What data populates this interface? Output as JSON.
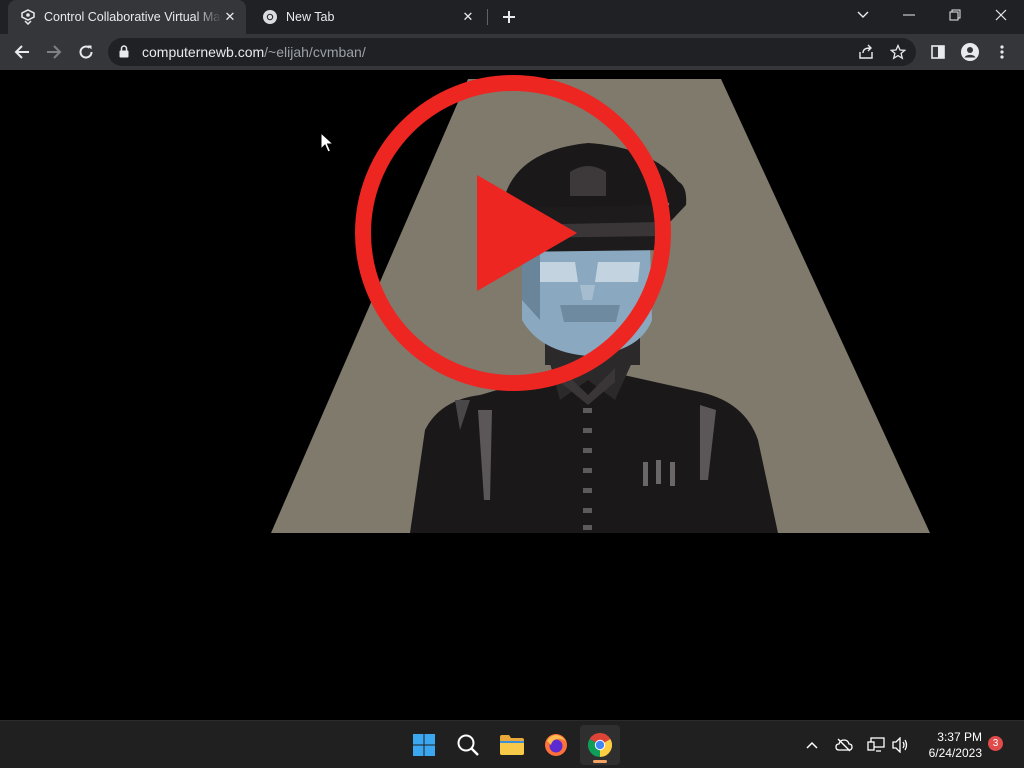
{
  "browser": {
    "tabs": [
      {
        "title": "Control Collaborative Virtual Mac",
        "active": true,
        "favicon": "cvm-favicon-icon"
      },
      {
        "title": "New Tab",
        "active": false,
        "favicon": "chrome-icon"
      }
    ],
    "url": {
      "host": "computernewb.com",
      "path": "/~elijah/cvmban/"
    }
  },
  "content": {
    "media": "video-thumbnail",
    "overlay": "play-button"
  },
  "taskbar": {
    "apps": [
      "windows-start-icon",
      "search-icon",
      "file-explorer-icon",
      "firefox-icon",
      "chrome-icon"
    ],
    "clock": {
      "time": "3:37 PM",
      "date": "6/24/2023"
    },
    "notification_count": "3"
  },
  "colors": {
    "tabstrip": "#202124",
    "toolbar": "#35363a",
    "play_red": "#ee2622",
    "spotlight": "#7f7a6c",
    "taskbar": "#202020"
  }
}
